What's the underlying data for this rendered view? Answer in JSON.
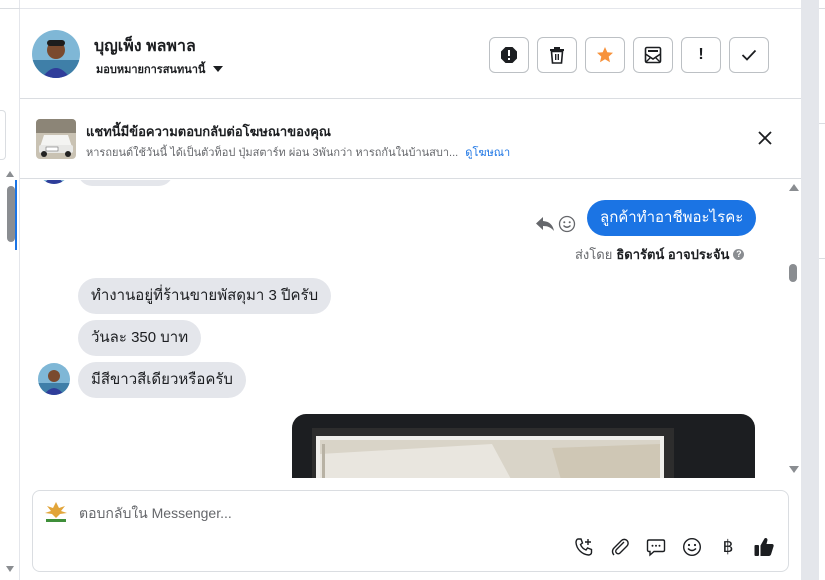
{
  "header": {
    "contact_name": "บุญเพ็ง พลพาล",
    "assign_label": "มอบหมายการสนทนานี้",
    "actions": [
      {
        "name": "spam-icon",
        "color": "#1c1e21"
      },
      {
        "name": "trash-icon",
        "color": "#1c1e21"
      },
      {
        "name": "star-icon",
        "color": "#f7923b"
      },
      {
        "name": "mark-unread-icon",
        "color": "#1c1e21"
      },
      {
        "name": "exclamation-icon",
        "color": "#1c1e21"
      },
      {
        "name": "check-icon",
        "color": "#1c1e21"
      }
    ],
    "important_label": "!"
  },
  "ad_banner": {
    "title": "แชทนี้มีข้อความตอบกลับต่อโฆษณาของคุณ",
    "subtitle": "หารถยนต์ใช้วันนี้ ได้เป็นตัวท็อป ปุ่มสตาร์ท ผ่อน 3พันกว่า หารถกันในบ้านสบา...",
    "link_label": "ดูโฆษณา"
  },
  "messages": [
    {
      "id": "out-1",
      "direction": "outgoing",
      "text": "ลูกค้าทำอาชีพอะไรคะ"
    },
    {
      "id": "in-1",
      "direction": "incoming",
      "text": "ทำงานอยู่ที่ร้านขายพัสดุมา 3 ปีครับ"
    },
    {
      "id": "in-2",
      "direction": "incoming",
      "text": "วันละ 350 บาท"
    },
    {
      "id": "in-3",
      "direction": "incoming",
      "text": "มีสีขาวสีเดียวหรือครับ"
    }
  ],
  "sent_by": {
    "prefix": "ส่งโดย",
    "agent_name": "ธิดารัตน์ อาจประจัน",
    "help": "?"
  },
  "composer": {
    "placeholder": "ตอบกลับใน Messenger...",
    "tools": [
      "call-add-icon",
      "attachment-icon",
      "saved-reply-icon",
      "emoji-icon",
      "payment-icon",
      "like-icon"
    ],
    "baht_symbol": "฿"
  },
  "colors": {
    "accent": "#1b74e4",
    "bubble_incoming": "#e4e6eb",
    "star": "#f7923b"
  }
}
